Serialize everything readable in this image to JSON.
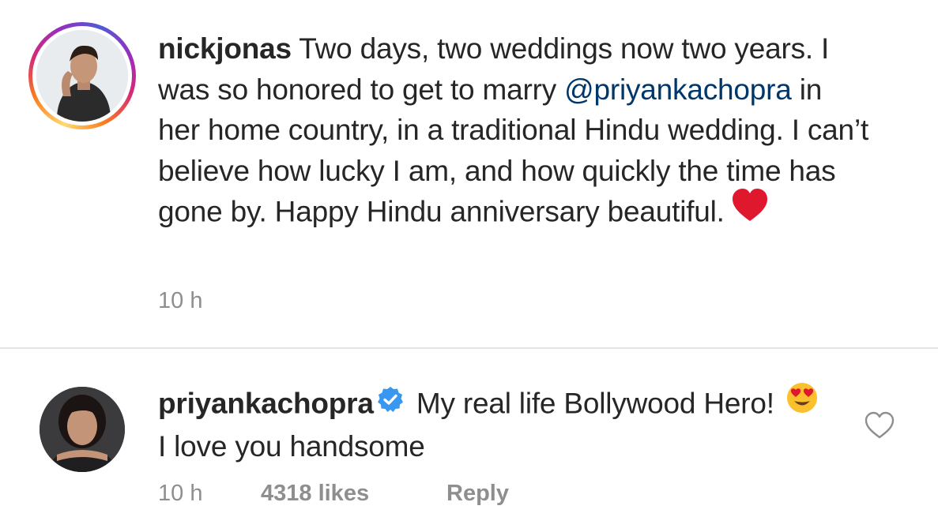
{
  "post": {
    "username": "nickjonas",
    "text_before_mention": " Two days, two weddings now two years. I was so honored to get to marry ",
    "mention": "@priyankachopra",
    "text_after_mention": " in her home country, in a traditional Hindu wedding. I can’t believe how lucky I am, and how quickly the time has gone by. Happy Hindu anniversary beautiful.",
    "emoji": "red-heart",
    "time": "10 h"
  },
  "reply": {
    "username": "priyankachopra",
    "verified": true,
    "text_part1": " My real life Bollywood Hero! ",
    "emoji": "heart-eyes",
    "text_part2": " I love you handsome",
    "time": "10 h",
    "likes": "4318 likes",
    "reply_label": "Reply"
  },
  "colors": {
    "text": "#262626",
    "mention": "#00376b",
    "muted": "#8e8e8e",
    "verified": "#3897f0",
    "heart": "#e0182d"
  }
}
